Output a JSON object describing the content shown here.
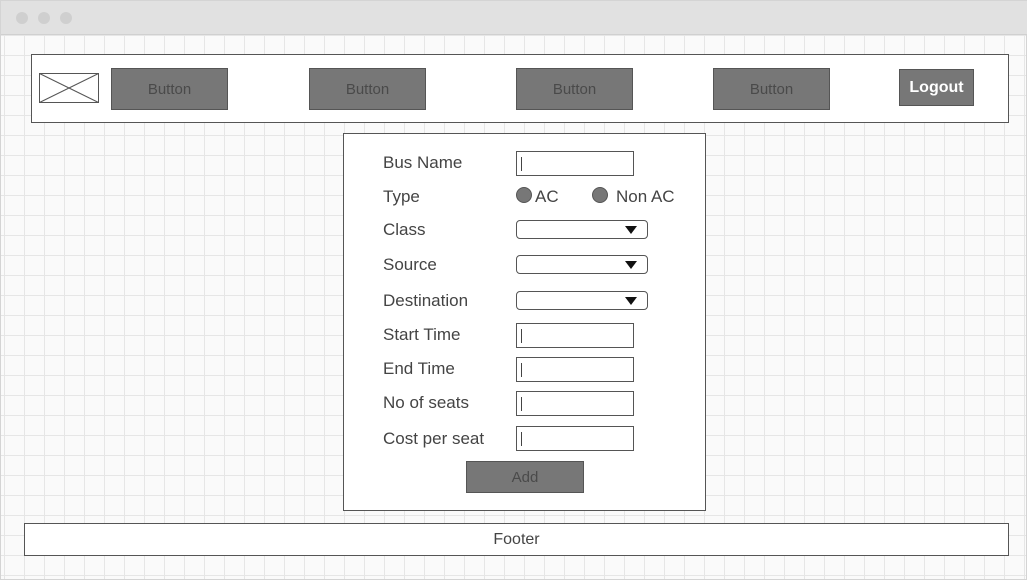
{
  "navbar": {
    "buttons": [
      "Button",
      "Button",
      "Button",
      "Button"
    ],
    "logout_label": "Logout"
  },
  "form": {
    "bus_name_label": "Bus Name",
    "type_label": "Type",
    "type_options": [
      "AC",
      "Non AC"
    ],
    "class_label": "Class",
    "source_label": "Source",
    "destination_label": "Destination",
    "start_time_label": "Start Time",
    "end_time_label": "End Time",
    "seats_label": "No of seats",
    "cost_label": "Cost per seat",
    "add_label": "Add"
  },
  "footer": {
    "text": "Footer"
  },
  "icons": {
    "logo": "image-placeholder-icon",
    "dropdown": "chevron-down-icon"
  },
  "colors": {
    "button_fill": "#777777",
    "border": "#555555"
  }
}
